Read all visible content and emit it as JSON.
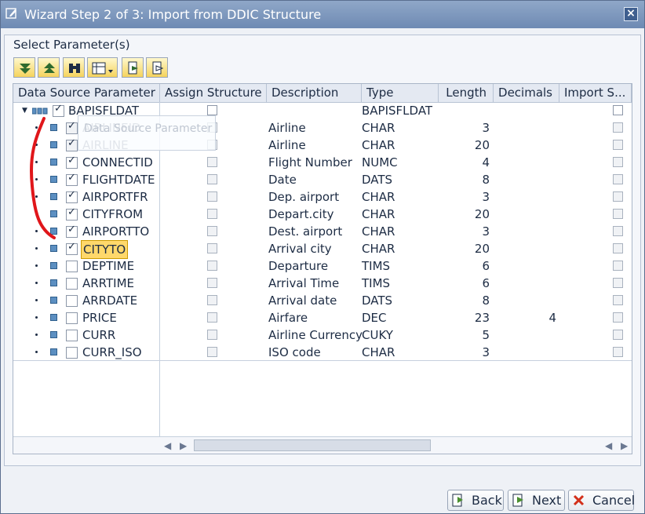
{
  "window": {
    "title": "Wizard Step 2 of 3: Import from DDIC Structure"
  },
  "frame": {
    "title": "Select Parameter(s)"
  },
  "toolbar": {
    "icons": [
      "expand-all-icon",
      "collapse-all-icon",
      "binoculars-icon",
      "layout-icon",
      "select-all-icon",
      "deselect-all-icon"
    ]
  },
  "table": {
    "headers": [
      "Data Source Parameter",
      "Assign Structure",
      "Description",
      "Type",
      "Length",
      "Decimals",
      "Import S..."
    ],
    "root": {
      "label": "BAPISFLDAT",
      "type": "BAPISFLDAT"
    },
    "rows": [
      {
        "param": "AIRLINEID",
        "checked": true,
        "disabled": true,
        "desc": "Airline",
        "type": "CHAR",
        "length": "3",
        "decimals": ""
      },
      {
        "param": "AIRLINE",
        "checked": true,
        "disabled": true,
        "desc": "Airline",
        "type": "CHAR",
        "length": "20",
        "decimals": ""
      },
      {
        "param": "CONNECTID",
        "checked": true,
        "disabled": false,
        "desc": "Flight Number",
        "type": "NUMC",
        "length": "4",
        "decimals": ""
      },
      {
        "param": "FLIGHTDATE",
        "checked": true,
        "disabled": false,
        "desc": "Date",
        "type": "DATS",
        "length": "8",
        "decimals": ""
      },
      {
        "param": "AIRPORTFR",
        "checked": true,
        "disabled": false,
        "desc": "Dep. airport",
        "type": "CHAR",
        "length": "3",
        "decimals": ""
      },
      {
        "param": "CITYFROM",
        "checked": true,
        "disabled": false,
        "desc": "Depart.city",
        "type": "CHAR",
        "length": "20",
        "decimals": ""
      },
      {
        "param": "AIRPORTTO",
        "checked": true,
        "disabled": false,
        "desc": "Dest. airport",
        "type": "CHAR",
        "length": "3",
        "decimals": ""
      },
      {
        "param": "CITYTO",
        "checked": true,
        "disabled": false,
        "selected": true,
        "desc": "Arrival city",
        "type": "CHAR",
        "length": "20",
        "decimals": ""
      },
      {
        "param": "DEPTIME",
        "checked": false,
        "disabled": false,
        "desc": "Departure",
        "type": "TIMS",
        "length": "6",
        "decimals": ""
      },
      {
        "param": "ARRTIME",
        "checked": false,
        "disabled": false,
        "desc": "Arrival Time",
        "type": "TIMS",
        "length": "6",
        "decimals": ""
      },
      {
        "param": "ARRDATE",
        "checked": false,
        "disabled": false,
        "desc": "Arrival date",
        "type": "DATS",
        "length": "8",
        "decimals": ""
      },
      {
        "param": "PRICE",
        "checked": false,
        "disabled": false,
        "desc": "Airfare",
        "type": "DEC",
        "length": "23",
        "decimals": "4"
      },
      {
        "param": "CURR",
        "checked": false,
        "disabled": false,
        "desc": "Airline Currency",
        "type": "CUKY",
        "length": "5",
        "decimals": ""
      },
      {
        "param": "CURR_ISO",
        "checked": false,
        "disabled": false,
        "desc": "ISO code",
        "type": "CHAR",
        "length": "3",
        "decimals": ""
      }
    ]
  },
  "ghost": {
    "text": "Data Source Parameter"
  },
  "buttons": {
    "back": "Back",
    "next": "Next",
    "cancel": "Cancel"
  },
  "colors": {
    "selected": "#ffd86b",
    "accent": "#6e8ab3",
    "annotation": "#e0161a"
  }
}
